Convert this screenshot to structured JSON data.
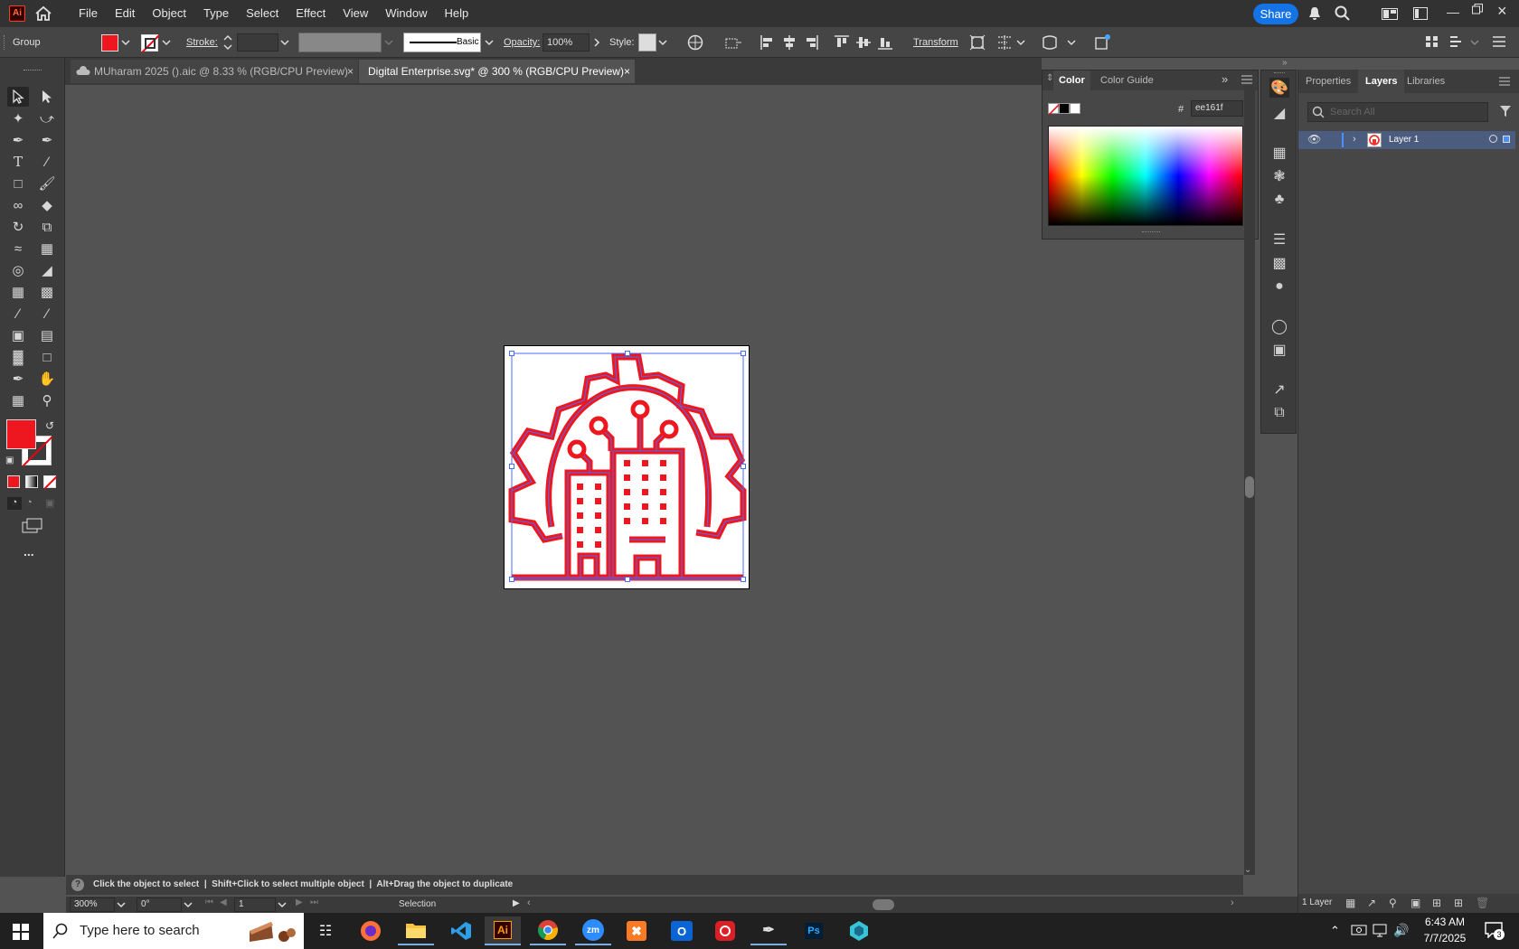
{
  "menubar": {
    "logo": "Ai",
    "items": [
      "File",
      "Edit",
      "Object",
      "Type",
      "Select",
      "Effect",
      "View",
      "Window",
      "Help"
    ],
    "share_label": "Share"
  },
  "controlbar": {
    "selection_type": "Group",
    "fill_color": "#ee161f",
    "stroke_label": "Stroke:",
    "brush_label": "Basic",
    "opacity_label": "Opacity:",
    "opacity_value": "100%",
    "style_label": "Style:",
    "transform_label": "Transform"
  },
  "tabs": [
    {
      "label": "MUharam 2025 ().aic @ 8.33 % (RGB/CPU Preview)",
      "active": false
    },
    {
      "label": "Digital Enterprise.svg* @ 300 % (RGB/CPU Preview)",
      "active": true
    }
  ],
  "toolbar": {
    "fill_color": "#ee161f",
    "more_label": "..."
  },
  "color_panel": {
    "tabs": [
      "Color",
      "Color Guide"
    ],
    "hex_label": "#",
    "hex_value": "ee161f"
  },
  "layers_panel": {
    "tabs": [
      "Properties",
      "Layers",
      "Libraries"
    ],
    "search_placeholder": "Search All",
    "layers": [
      {
        "name": "Layer 1",
        "visible": true
      }
    ],
    "footer_count": "1 Layer"
  },
  "artwork": {
    "accent": "#ee161f",
    "selection_color": "#4a6cf7"
  },
  "status": {
    "hint": "Click the object to select  |  Shift+Click to select multiple object  |  Alt+Drag the object to duplicate",
    "zoom": "300%",
    "rotation": "0°",
    "artboard": "1",
    "tool": "Selection"
  },
  "taskbar": {
    "search_placeholder": "Type here to search",
    "time": "6:43 AM",
    "date": "7/7/2025",
    "notifications": "3",
    "apps": [
      "Task View",
      "Firefox",
      "File Explorer",
      "VS Code",
      "Illustrator",
      "Chrome",
      "Zoom",
      "XAMPP",
      "Outlook",
      "Creative Cloud",
      "Pen Tool",
      "Photoshop",
      "App"
    ]
  }
}
